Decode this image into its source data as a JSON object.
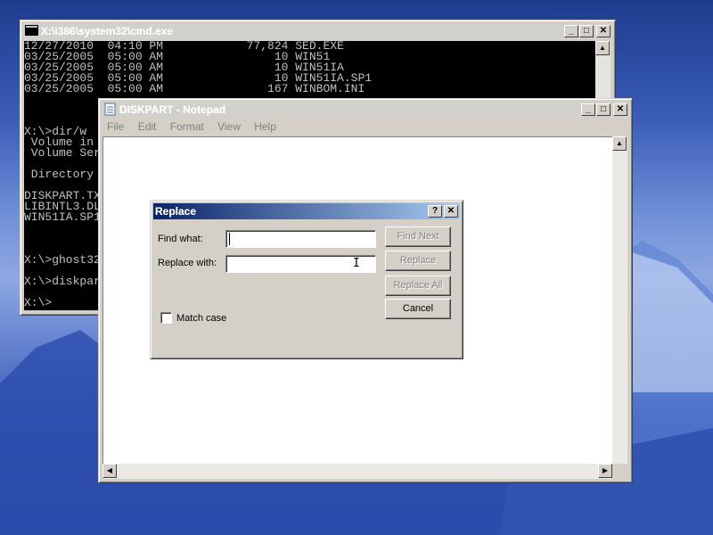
{
  "cmd": {
    "title": "X:\\i386\\system32\\cmd.exe",
    "lines": [
      "12/27/2010  04:10 PM            77,824 SED.EXE",
      "03/25/2005  05:00 AM                10 WIN51",
      "03/25/2005  05:00 AM                10 WIN51IA",
      "03/25/2005  05:00 AM                10 WIN51IA.SP1",
      "03/25/2005  05:00 AM               167 WINBOM.INI",
      "",
      "",
      "",
      "X:\\>dir/w",
      " Volume in",
      " Volume Ser",
      "",
      " Directory",
      "",
      "DISKPART.TX",
      "LIBINTL3.DL",
      "WIN51IA.SP1",
      "",
      "",
      "",
      "X:\\>ghost32",
      "",
      "X:\\>diskpar",
      "",
      "X:\\>"
    ]
  },
  "notepad": {
    "title": "DISKPART - Notepad",
    "menu": [
      "File",
      "Edit",
      "Format",
      "View",
      "Help"
    ]
  },
  "replace_dialog": {
    "title": "Replace",
    "find_label": "Find what:",
    "find_value": "",
    "replace_label": "Replace with:",
    "replace_value": "",
    "buttons": {
      "find_next": "Find Next",
      "replace": "Replace",
      "replace_all": "Replace All",
      "cancel": "Cancel"
    },
    "match_case_label": "Match case",
    "match_case_checked": false
  },
  "icons": {
    "title_help": "?",
    "title_close": "✕",
    "minimize": "_",
    "maximize": "□",
    "close": "✕"
  }
}
